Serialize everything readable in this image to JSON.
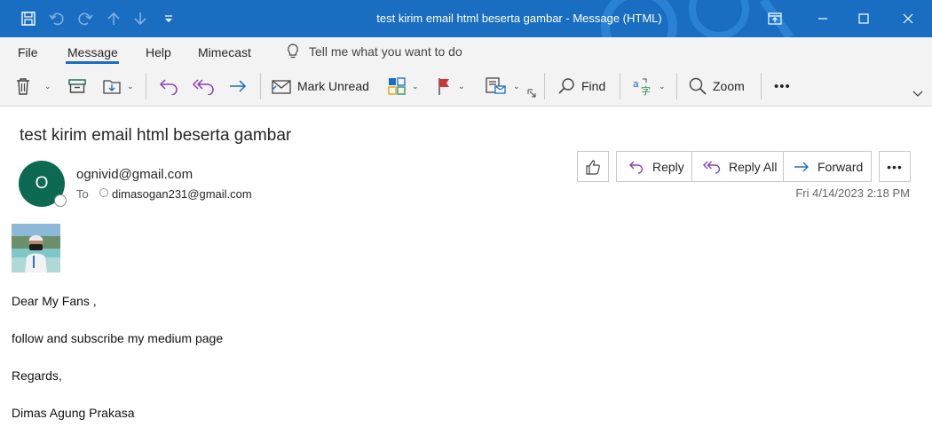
{
  "window": {
    "title": "test kirim email html beserta gambar  -  Message (HTML)"
  },
  "menu": {
    "items": [
      "File",
      "Message",
      "Help",
      "Mimecast"
    ],
    "active": "Message",
    "tell_me": "Tell me what you want to do"
  },
  "ribbon": {
    "mark_unread": "Mark Unread",
    "find": "Find",
    "zoom": "Zoom",
    "more": "•••"
  },
  "message": {
    "subject": "test kirim email html beserta gambar",
    "avatar_initial": "O",
    "sender": "ognivid@gmail.com",
    "to_label": "To",
    "to_address": "dimasogan231@gmail.com",
    "date": "Fri 4/14/2023 2:18 PM",
    "reply": "Reply",
    "reply_all": "Reply All",
    "forward": "Forward",
    "more": "•••",
    "body": [
      "Dear My Fans ,",
      "follow and subscribe my medium page",
      "Regards,",
      "Dimas Agung Prakasa"
    ]
  },
  "colors": {
    "titlebar": "#1a6ec2",
    "accent": "#1a6ec2",
    "avatar": "#0d6a52",
    "reply_purple": "#8b3fb8",
    "forward_blue": "#1a6ec2",
    "flag_red": "#d13438"
  }
}
